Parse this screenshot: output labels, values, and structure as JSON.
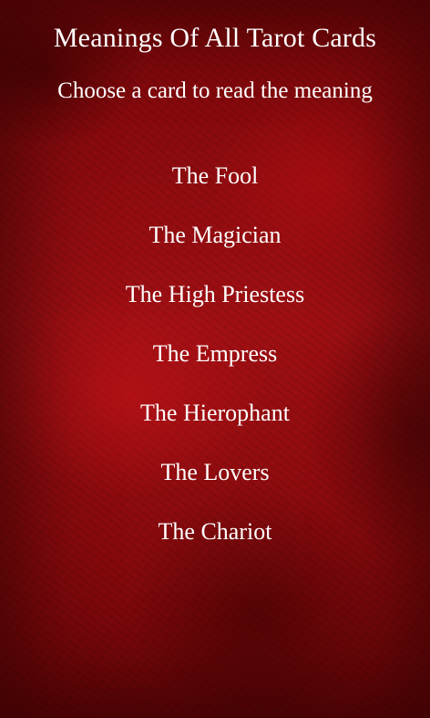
{
  "header": {
    "title": "Meanings Of All Tarot Cards",
    "subtitle": "Choose a card to read the meaning"
  },
  "cards": [
    {
      "label": "The Fool"
    },
    {
      "label": "The Magician"
    },
    {
      "label": "The High Priestess"
    },
    {
      "label": "The Empress"
    },
    {
      "label": "The Hierophant"
    },
    {
      "label": "The Lovers"
    },
    {
      "label": "The Chariot"
    }
  ],
  "theme": {
    "background": "#8c0b0e",
    "text": "#ffffff"
  }
}
